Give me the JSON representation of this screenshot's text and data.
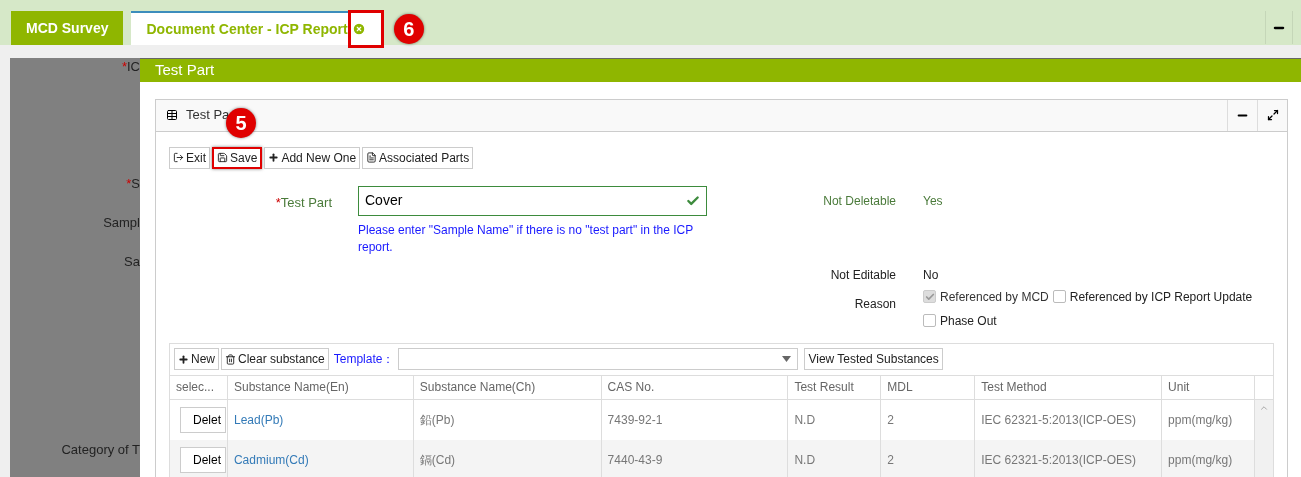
{
  "tabs": [
    {
      "label": "MCD Survey",
      "selected": false,
      "closable": false
    },
    {
      "label": "Document Center - ICP Report",
      "selected": true,
      "closable": true,
      "annotation": "6"
    }
  ],
  "background_form": {
    "labels": [
      {
        "required_mark": "*",
        "text": "IC"
      },
      {
        "required_mark": "*",
        "text": "S"
      },
      {
        "text": "Sampl"
      },
      {
        "text": "Sa"
      },
      {
        "text": "Category of T"
      }
    ]
  },
  "modal": {
    "title": "Test Part",
    "panel": {
      "title": "Test Pa",
      "toolbar": [
        {
          "kind": "exit",
          "label": "Exit"
        },
        {
          "kind": "save",
          "label": "Save",
          "annotation": "5"
        },
        {
          "kind": "add",
          "label": "Add New One"
        },
        {
          "kind": "doc",
          "label": "Associated Parts"
        }
      ],
      "test_part": {
        "required_mark": "*",
        "label": "Test Part",
        "value": "Cover",
        "valid": true,
        "hint": "Please enter \"Sample Name\" if there is no \"test part\" in the ICP report."
      },
      "not_deletable": {
        "label": "Not Deletable",
        "value": "Yes"
      },
      "not_editable": {
        "label": "Not Editable",
        "value": "No"
      },
      "reason": {
        "label": "Reason",
        "options": [
          {
            "label": "Referenced by MCD",
            "checked": true,
            "disabled": true
          },
          {
            "label": "Referenced by ICP Report Update",
            "checked": false,
            "disabled": false
          },
          {
            "label": "Phase Out",
            "checked": false,
            "disabled": false
          }
        ]
      },
      "grid": {
        "toolbar": [
          {
            "kind": "add",
            "label": "New"
          },
          {
            "kind": "trash",
            "label": "Clear substance"
          }
        ],
        "template_label": "Template：",
        "view_button": "View Tested Substances",
        "columns": [
          "selec...",
          "Substance Name(En)",
          "Substance Name(Ch)",
          "CAS No.",
          "Test Result",
          "MDL",
          "Test Method",
          "Unit"
        ],
        "rows": [
          {
            "cells": [
              "Delet",
              "Lead(Pb)",
              "鉛(Pb)",
              "7439-92-1",
              "N.D",
              "2",
              "IEC 62321-5:2013(ICP-OES)",
              "ppm(mg/kg)"
            ]
          },
          {
            "cells": [
              "Delet",
              "Cadmium(Cd)",
              "鎘(Cd)",
              "7440-43-9",
              "N.D",
              "2",
              "IEC 62321-5:2013(ICP-OES)",
              "ppm(mg/kg)"
            ]
          }
        ]
      }
    }
  }
}
